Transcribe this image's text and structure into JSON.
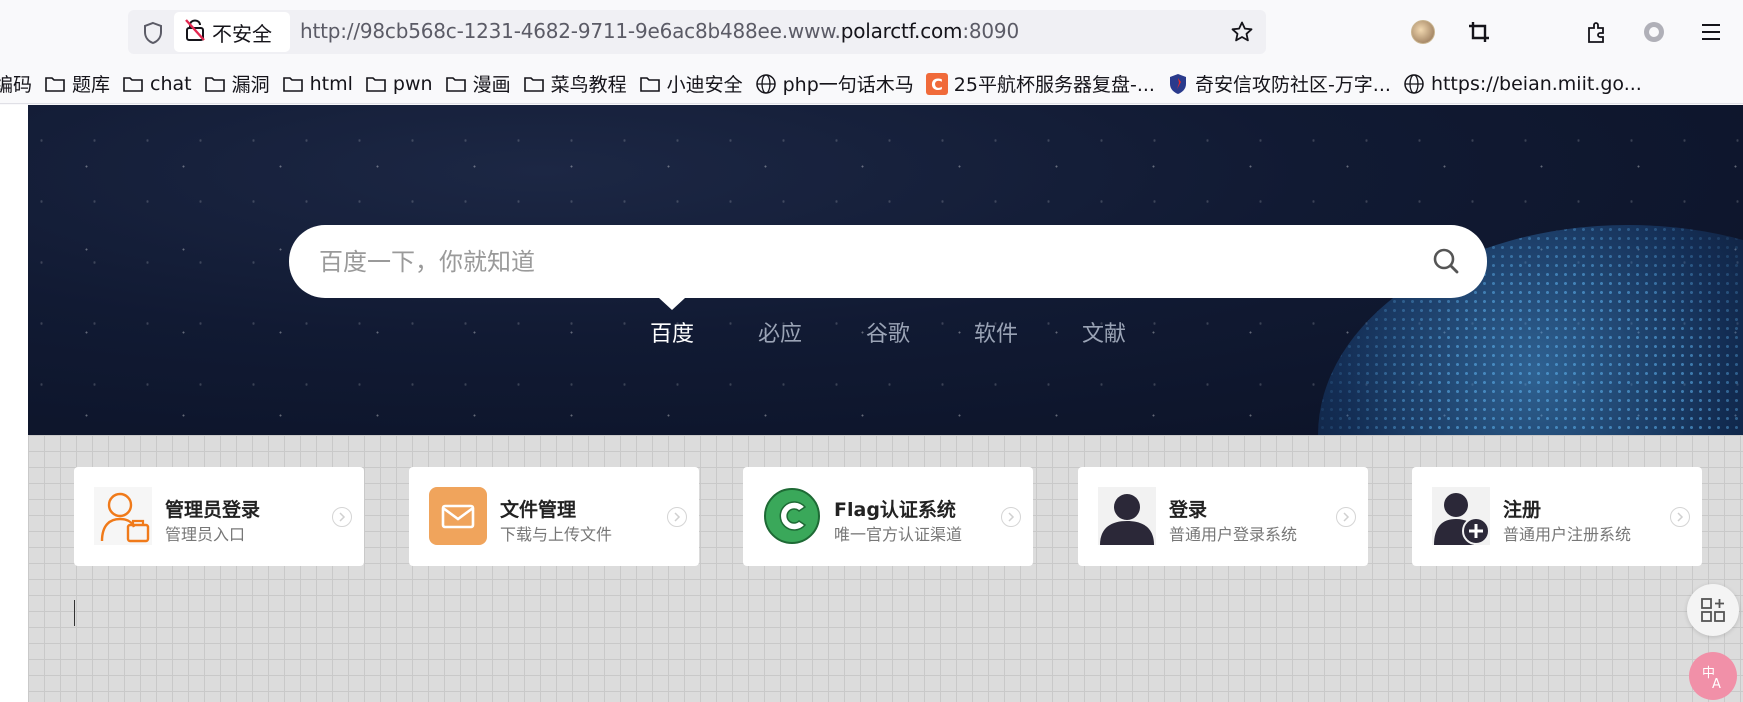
{
  "browser": {
    "security_label": "不安全",
    "url_prefix": "http://98cb568c-1231-4682-9711-9e6ac8b488ee.www.",
    "url_host": "polarctf.com",
    "url_suffix": ":8090"
  },
  "bookmarks": [
    {
      "label": "编码",
      "icon": "none"
    },
    {
      "label": "题库",
      "icon": "folder-icon"
    },
    {
      "label": "chat",
      "icon": "folder-icon"
    },
    {
      "label": "漏洞",
      "icon": "folder-icon"
    },
    {
      "label": "html",
      "icon": "folder-icon"
    },
    {
      "label": "pwn",
      "icon": "folder-icon"
    },
    {
      "label": "漫画",
      "icon": "folder-icon"
    },
    {
      "label": "菜鸟教程",
      "icon": "folder-icon"
    },
    {
      "label": "小迪安全",
      "icon": "folder-icon"
    },
    {
      "label": "php一句话木马",
      "icon": "globe-icon"
    },
    {
      "label": "25平航杯服务器复盘-...",
      "icon": "c-logo-icon"
    },
    {
      "label": "奇安信攻防社区-万字...",
      "icon": "qianxin-logo-icon"
    },
    {
      "label": "https://beian.miit.go...",
      "icon": "globe-icon"
    }
  ],
  "search": {
    "placeholder": "百度一下，你就知道"
  },
  "engines": [
    {
      "label": "百度",
      "active": true
    },
    {
      "label": "必应",
      "active": false
    },
    {
      "label": "谷歌",
      "active": false
    },
    {
      "label": "软件",
      "active": false
    },
    {
      "label": "文献",
      "active": false
    }
  ],
  "cards": [
    {
      "title": "管理员登录",
      "subtitle": "管理员入口",
      "icon": "admin-user-icon"
    },
    {
      "title": "文件管理",
      "subtitle": "下载与上传文件",
      "icon": "mail-icon"
    },
    {
      "title": "Flag认证系统",
      "subtitle": "唯一官方认证渠道",
      "icon": "flag-c-icon"
    },
    {
      "title": "登录",
      "subtitle": "普通用户登录系统",
      "icon": "user-icon"
    },
    {
      "title": "注册",
      "subtitle": "普通用户注册系统",
      "icon": "user-add-icon"
    }
  ],
  "colors": {
    "accent_orange": "#f0a45c",
    "flag_green": "#3aa85a",
    "hero_bg": "#111a33"
  }
}
